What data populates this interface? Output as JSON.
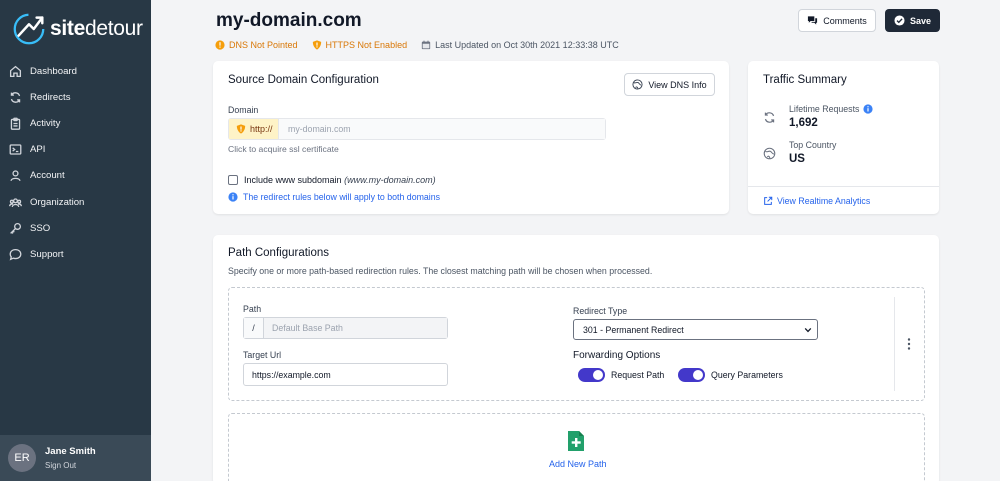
{
  "app": {
    "brand_bold": "site",
    "brand_light": "detour"
  },
  "sidebar": {
    "items": [
      {
        "label": "Dashboard",
        "icon": "home-icon"
      },
      {
        "label": "Redirects",
        "icon": "refresh-icon"
      },
      {
        "label": "Activity",
        "icon": "clipboard-icon"
      },
      {
        "label": "API",
        "icon": "terminal-icon"
      },
      {
        "label": "Account",
        "icon": "user-icon"
      },
      {
        "label": "Organization",
        "icon": "users-icon"
      },
      {
        "label": "SSO",
        "icon": "key-icon"
      },
      {
        "label": "Support",
        "icon": "chat-icon"
      }
    ],
    "user": {
      "initials": "ER",
      "name": "Jane Smith",
      "sign_out": "Sign Out"
    }
  },
  "header": {
    "title": "my-domain.com",
    "statuses": {
      "dns": "DNS Not Pointed",
      "https": "HTTPS Not Enabled",
      "updated": "Last Updated on Oct 30th 2021 12:33:38 UTC"
    },
    "comments_label": "Comments",
    "save_label": "Save"
  },
  "source": {
    "title": "Source Domain Configuration",
    "dns_button": "View DNS Info",
    "domain_label": "Domain",
    "protocol": "http://",
    "domain_placeholder": "my-domain.com",
    "ssl_hint": "Click to acquire ssl certificate",
    "www_label": "Include www subdomain",
    "www_example": "(www.my-domain.com)",
    "www_checked": false,
    "info_text": "The redirect rules below will apply to both domains"
  },
  "traffic": {
    "title": "Traffic Summary",
    "lifetime_label": "Lifetime Requests",
    "lifetime_value": "1,692",
    "country_label": "Top Country",
    "country_value": "US",
    "analytics_link": "View Realtime Analytics"
  },
  "paths": {
    "title": "Path Configurations",
    "subtitle": "Specify one or more path-based redirection rules. The closest matching path will be chosen when processed.",
    "path_label": "Path",
    "path_prefix": "/",
    "path_placeholder": "Default Base Path",
    "target_label": "Target Url",
    "target_value": "https://example.com",
    "redirect_type_label": "Redirect Type",
    "redirect_type_value": "301 - Permanent Redirect",
    "forwarding_title": "Forwarding Options",
    "request_path_label": "Request Path",
    "request_path_on": true,
    "query_params_label": "Query Parameters",
    "query_params_on": true,
    "add_label": "Add New Path"
  },
  "colors": {
    "sidebar_bg": "#283845",
    "warning": "#d97706",
    "link": "#2563eb",
    "toggle_on": "#4338ca",
    "add_green": "#22a06b"
  }
}
